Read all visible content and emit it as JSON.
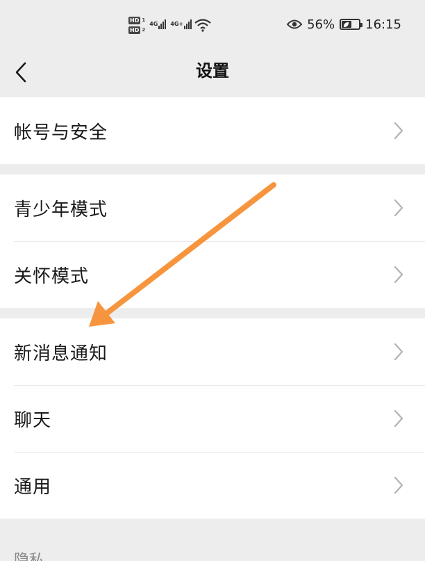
{
  "status_bar": {
    "hd1": "HD",
    "hd1_num": "1",
    "hd2": "HD",
    "hd2_num": "2",
    "net1": "4G",
    "net2": "4G+",
    "battery_percent": "56%",
    "battery_level": 0.56,
    "time": "16:15",
    "icons": [
      "eye-icon",
      "wifi-icon",
      "leaf-icon"
    ]
  },
  "nav": {
    "title": "设置",
    "back_icon": "chevron-left-icon"
  },
  "groups": [
    {
      "items": [
        {
          "label": "帐号与安全"
        }
      ]
    },
    {
      "items": [
        {
          "label": "青少年模式"
        },
        {
          "label": "关怀模式"
        }
      ]
    },
    {
      "items": [
        {
          "label": "新消息通知"
        },
        {
          "label": "聊天"
        },
        {
          "label": "通用"
        }
      ]
    }
  ],
  "section_header": "隐私",
  "annotation": {
    "color": "#f7953f",
    "type": "arrow"
  }
}
